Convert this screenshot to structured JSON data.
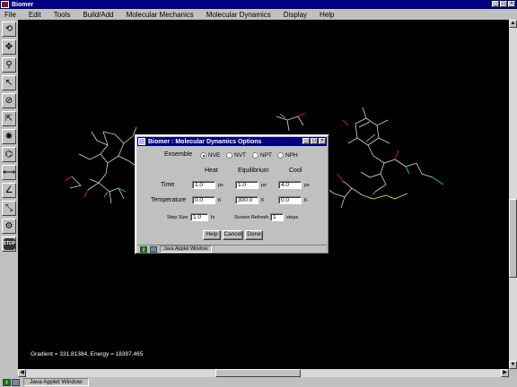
{
  "window": {
    "title": "Biomer",
    "controls": [
      "_",
      "□",
      "×"
    ]
  },
  "menubar": {
    "items": [
      "File",
      "Edit",
      "Tools",
      "Build/Add",
      "Molecular Mechanics",
      "Molecular Dynamics",
      "Display",
      "Help"
    ]
  },
  "toolbar": {
    "tools": [
      "rotate-icon",
      "move-icon",
      "zoom-icon",
      "select-arrow-icon",
      "lasso-icon",
      "select-atom-icon",
      "add-atom-icon",
      "build-icon",
      "measure-distance-icon",
      "measure-angle-icon",
      "measure-torsion-icon",
      "torsion-drive-icon",
      "stop-icon"
    ],
    "stop_label": "STOP"
  },
  "canvas": {
    "status": "Gradient = 331.81384, Energy = 18397.465"
  },
  "dialog": {
    "title": "Biomer : Molecular Dynamics Options",
    "ensemble_label": "Ensemble",
    "ensembles": [
      "NVE",
      "NVT",
      "NPT",
      "NPH"
    ],
    "selected_ensemble": "NVE",
    "col_heat": "Heat",
    "col_equilibrium": "Equilibrium",
    "col_cool": "Cool",
    "row_time": "Time",
    "row_temperature": "Temperature",
    "time_heat": "1.0",
    "time_equilibrium": "1.0",
    "time_cool": "4.0",
    "temp_heat": "0.0",
    "temp_equilibrium": "300.0",
    "temp_cool": "0.0",
    "unit_ps": "ps",
    "unit_k": "K",
    "step_size_label": "Step Size",
    "step_size_value": "1.0",
    "step_size_unit": "fs",
    "screen_refresh_label": "Screen Refresh",
    "screen_refresh_value": "1",
    "screen_refresh_unit": "steps",
    "help_button": "Help",
    "cancel_button": "Cancel",
    "done_button": "Done",
    "status_text": "Java Applet Window"
  },
  "bottombar": {
    "label": "Java Applet Window"
  },
  "colors": {
    "titlebar": "#000080",
    "face": "#c0c0c0",
    "canvas": "#000000"
  }
}
